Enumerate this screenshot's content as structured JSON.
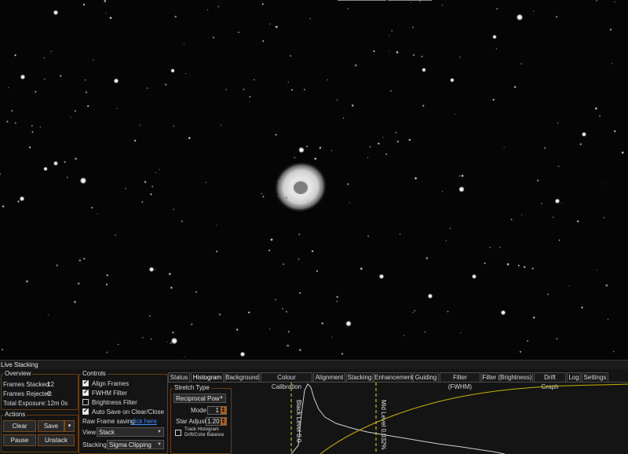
{
  "panel_title": "Live Stacking",
  "overview": {
    "legend": "Overview",
    "frames_stacked_label": "Frames Stacked:",
    "frames_stacked_value": "12",
    "frames_rejected_label": "Frames Rejected:",
    "frames_rejected_value": "0",
    "total_exposure_label": "Total Exposure:",
    "total_exposure_value": "12m 0s"
  },
  "actions": {
    "legend": "Actions",
    "clear": "Clear",
    "save": "Save",
    "save_dropdown": "▾",
    "pause": "Pause",
    "unstack": "Unstack"
  },
  "controls": {
    "legend": "Controls",
    "align_frames": {
      "label": "Align Frames",
      "checked": true
    },
    "fwhm_filter": {
      "label": "FWHM Filter",
      "checked": true
    },
    "brightness_filter": {
      "label": "Brightness Filter",
      "checked": false
    },
    "auto_save": {
      "label": "Auto Save on Clear/Close",
      "checked": true
    },
    "raw_frame_label": "Raw Frame saving",
    "raw_frame_link": "click here",
    "view_label": "View",
    "view_value": "Stack",
    "stacking_label": "Stacking",
    "stacking_value": "Sigma Clipping"
  },
  "tabs": [
    "Status",
    "Histogram",
    "Background",
    "Colour Calibration",
    "Alignment",
    "Stacking",
    "Enhancement",
    "Guiding",
    "Filter (FWHM)",
    "Filter (Brightness)",
    "Drift Graph",
    "Log",
    "Settings"
  ],
  "active_tab": "Histogram",
  "stretch": {
    "legend": "Stretch Type",
    "type_value": "Reciprocal Pow",
    "mode_label": "Mode",
    "mode_value": "1",
    "star_adjust_label": "Star Adjust",
    "star_adjust_value": "1.20",
    "track_label_1": "Track Histogram",
    "track_label_2": "Drift/Color Balance",
    "track_checked": false
  },
  "histogram": {
    "black_level_label": "Black Level 0.0",
    "mid_level_label": "Mid Level 0.032%",
    "curve_color": "#c8b400",
    "marker_color": "#e8e000",
    "histogram_color": "#d0d0d0"
  },
  "colors": {
    "accent_border": "#6a3e12",
    "spinner_arrow": "#b35a0f",
    "link": "#3d8fff"
  }
}
